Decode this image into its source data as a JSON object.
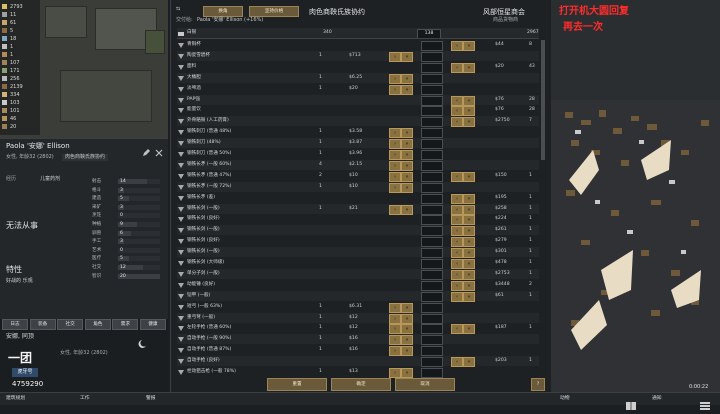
{
  "resources": [
    {
      "label": "2793",
      "color": "#d9c160"
    },
    {
      "label": "11",
      "color": "#9aa0a4"
    },
    {
      "label": "61",
      "color": "#c9a46a"
    },
    {
      "label": "5",
      "color": "#8b6a42"
    },
    {
      "label": "18",
      "color": "#7fa7c2"
    },
    {
      "label": "1",
      "color": "#c0c0c0"
    },
    {
      "label": "1",
      "color": "#b48a58"
    },
    {
      "label": "107",
      "color": "#a1835a"
    },
    {
      "label": "171",
      "color": "#8aa073"
    },
    {
      "label": "256",
      "color": "#b9b9b9"
    },
    {
      "label": "2139",
      "color": "#8b6a42"
    },
    {
      "label": "334",
      "color": "#d4b179"
    },
    {
      "label": "103",
      "color": "#c9c9c9"
    },
    {
      "label": "101",
      "color": "#a88b5b"
    },
    {
      "label": "46",
      "color": "#b8955a"
    },
    {
      "label": "20",
      "color": "#9c7e55"
    }
  ],
  "pawn": {
    "name": "Paola '安娜' Ellison",
    "sub": "女性, 年龄32 (2802)",
    "faction": "肉色商鞅氏族协约",
    "bio_label": "经历",
    "bio_text": "儿童药剂",
    "incapable_label": "无法从事",
    "traits_label": "特性",
    "traits_text": "好战的  乐观",
    "skills": [
      {
        "label": "射击",
        "value": "14",
        "frac": 0.7
      },
      {
        "label": "格斗",
        "value": "3",
        "frac": 0.15
      },
      {
        "label": "建造",
        "value": "5",
        "frac": 0.25
      },
      {
        "label": "采矿",
        "value": "3",
        "frac": 0.15
      },
      {
        "label": "烹饪",
        "value": "0",
        "frac": 0.0
      },
      {
        "label": "种植",
        "value": "9",
        "frac": 0.45
      },
      {
        "label": "驯兽",
        "value": "6",
        "frac": 0.3
      },
      {
        "label": "手工",
        "value": "3",
        "frac": 0.15
      },
      {
        "label": "艺术",
        "value": "0",
        "frac": 0.0
      },
      {
        "label": "医疗",
        "value": "5",
        "frac": 0.25
      },
      {
        "label": "社交",
        "value": "12",
        "frac": 0.6
      },
      {
        "label": "智识",
        "value": "20",
        "frac": 1.0
      }
    ],
    "tabs": [
      "日志",
      "装备",
      "社交",
      "角色",
      "需求",
      "健康"
    ]
  },
  "bottom_left": {
    "name": "安娜, 同顶",
    "sub": "女性, 年龄32 (2802)",
    "watermark_num": "一团",
    "watermark_name": "虎牙号",
    "room_id": "4759290"
  },
  "trade": {
    "left_btn1": "换角",
    "left_btn2": "坚持价格",
    "title": "肉色商鞅氏族协约",
    "trader_title": "风部恒星商会",
    "trader_sub": "商品货物商",
    "pawn_label": "交付给:",
    "pawn_name": "Paola '安娜' Ellison (+16%)",
    "silver_label": "白银",
    "silver_col": "340",
    "silver_field": "138",
    "silver_trader": "2967",
    "rows": [
      {
        "name": "青铜杯",
        "cq": "",
        "cp": "",
        "fld": "",
        "tp": "$44",
        "tq": "8"
      },
      {
        "name": "陶瓷雪碧杯",
        "cq": "1",
        "cp": "$713",
        "fld": "",
        "tp": "",
        "tq": ""
      },
      {
        "name": "面料",
        "cq": "",
        "cp": "",
        "fld": "",
        "tp": "$20",
        "tq": "43"
      },
      {
        "name": "大桶胆",
        "cq": "1",
        "cp": "$6.25",
        "fld": "",
        "tp": "",
        "tq": ""
      },
      {
        "name": "淡啤酒",
        "cq": "1",
        "cp": "$20",
        "fld": "",
        "tp": "",
        "tq": ""
      },
      {
        "name": "PAP强",
        "cq": "",
        "cp": "",
        "fld": "",
        "tp": "$76",
        "tq": "28"
      },
      {
        "name": "能量饮",
        "cq": "",
        "cp": "",
        "fld": "",
        "tp": "$76",
        "tq": "28"
      },
      {
        "name": "外骨骼毁 (人工药膏)",
        "cq": "",
        "cp": "",
        "fld": "",
        "tp": "$2750",
        "tq": "7"
      },
      {
        "name": "钢铁刺刀 (普通 48%)",
        "cq": "1",
        "cp": "$3.58",
        "fld": "",
        "tp": "",
        "tq": ""
      },
      {
        "name": "钢铁刺刀 (48%)",
        "cq": "1",
        "cp": "$3.87",
        "fld": "",
        "tp": "",
        "tq": ""
      },
      {
        "name": "钢铁刺刀 (普通 50%)",
        "cq": "1",
        "cp": "$3.96",
        "fld": "",
        "tp": "",
        "tq": ""
      },
      {
        "name": "钢铁长矛 (一般 60%)",
        "cq": "4",
        "cp": "$2.15",
        "fld": "",
        "tp": "",
        "tq": ""
      },
      {
        "name": "钢铁长矛 (普通 47%)",
        "cq": "2",
        "cp": "$10",
        "fld": "",
        "tp": "$150",
        "tq": "1"
      },
      {
        "name": "钢铁长矛 (一般 72%)",
        "cq": "1",
        "cp": "$10",
        "fld": "",
        "tp": "",
        "tq": ""
      },
      {
        "name": "钢铁长矛 (差)",
        "cq": "",
        "cp": "",
        "fld": "",
        "tp": "$195",
        "tq": "1"
      },
      {
        "name": "钢铁长剑 (一般)",
        "cq": "1",
        "cp": "$21",
        "fld": "",
        "tp": "$258",
        "tq": "1"
      },
      {
        "name": "钢铁长剑 (良好)",
        "cq": "",
        "cp": "",
        "fld": "",
        "tp": "$224",
        "tq": "1"
      },
      {
        "name": "钢铁长剑 (一般)",
        "cq": "",
        "cp": "",
        "fld": "",
        "tp": "$261",
        "tq": "1"
      },
      {
        "name": "钢铁长剑 (良好)",
        "cq": "",
        "cp": "",
        "fld": "",
        "tp": "$279",
        "tq": "1"
      },
      {
        "name": "钢铁长剑 (一般)",
        "cq": "",
        "cp": "",
        "fld": "",
        "tp": "$301",
        "tq": "1"
      },
      {
        "name": "钢铁长剑 (大师级)",
        "cq": "",
        "cp": "",
        "fld": "",
        "tp": "$478",
        "tq": "1"
      },
      {
        "name": "单分子剑 (一般)",
        "cq": "",
        "cp": "",
        "fld": "",
        "tp": "$2753",
        "tq": "1"
      },
      {
        "name": "动能锤 (良好)",
        "cq": "",
        "cp": "",
        "fld": "",
        "tp": "$3448",
        "tq": "2"
      },
      {
        "name": "铠甲 (一般)",
        "cq": "",
        "cp": "",
        "fld": "",
        "tp": "$61",
        "tq": "1"
      },
      {
        "name": "短弓 (一般 63%)",
        "cq": "1",
        "cp": "$6.31",
        "fld": "",
        "tp": "",
        "tq": ""
      },
      {
        "name": "重弓弩 (一般)",
        "cq": "1",
        "cp": "$12",
        "fld": "",
        "tp": "",
        "tq": ""
      },
      {
        "name": "左轮手枪 (普通 60%)",
        "cq": "1",
        "cp": "$12",
        "fld": "",
        "tp": "$187",
        "tq": "1"
      },
      {
        "name": "自动手枪 (一般 90%)",
        "cq": "1",
        "cp": "$16",
        "fld": "",
        "tp": "",
        "tq": ""
      },
      {
        "name": "自动手枪 (普通 87%)",
        "cq": "1",
        "cp": "$16",
        "fld": "",
        "tp": "",
        "tq": ""
      },
      {
        "name": "自动手枪 (良好)",
        "cq": "",
        "cp": "",
        "fld": "",
        "tp": "$203",
        "tq": "1"
      },
      {
        "name": "栓动狙击枪 (一般 78%)",
        "cq": "1",
        "cp": "$13",
        "fld": "",
        "tp": "",
        "tq": ""
      }
    ],
    "btn_accept": "重置",
    "btn_cancel": "确定",
    "btn_close": "取消",
    "close_x": "?"
  },
  "world": {
    "overlay_red": "打开机大圆回复",
    "overlay_red2": "再去一次",
    "timer": "0:00:22"
  },
  "bottom_bar": {
    "left1": "建筑规划",
    "left2": "工作",
    "left3": "警报",
    "right1": "动物",
    "right2": "通知"
  }
}
